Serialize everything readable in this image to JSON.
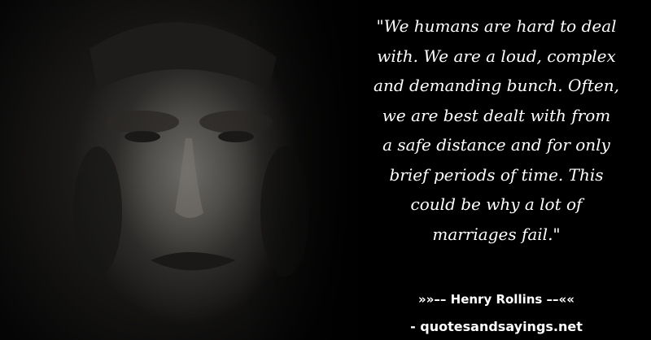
{
  "quote": {
    "lines": [
      "\"We humans are hard to deal",
      "with. We are a loud, complex",
      "and demanding bunch. Often,",
      "we are best dealt with from",
      "a safe distance and for only",
      "brief periods of time. This",
      "could be why a lot of",
      "marriages fail.\""
    ]
  },
  "author": "»»–– Henry Rollins ––««",
  "site": "- quotesandsayings.net",
  "colors": {
    "background": "#000000",
    "text": "#ffffff"
  }
}
